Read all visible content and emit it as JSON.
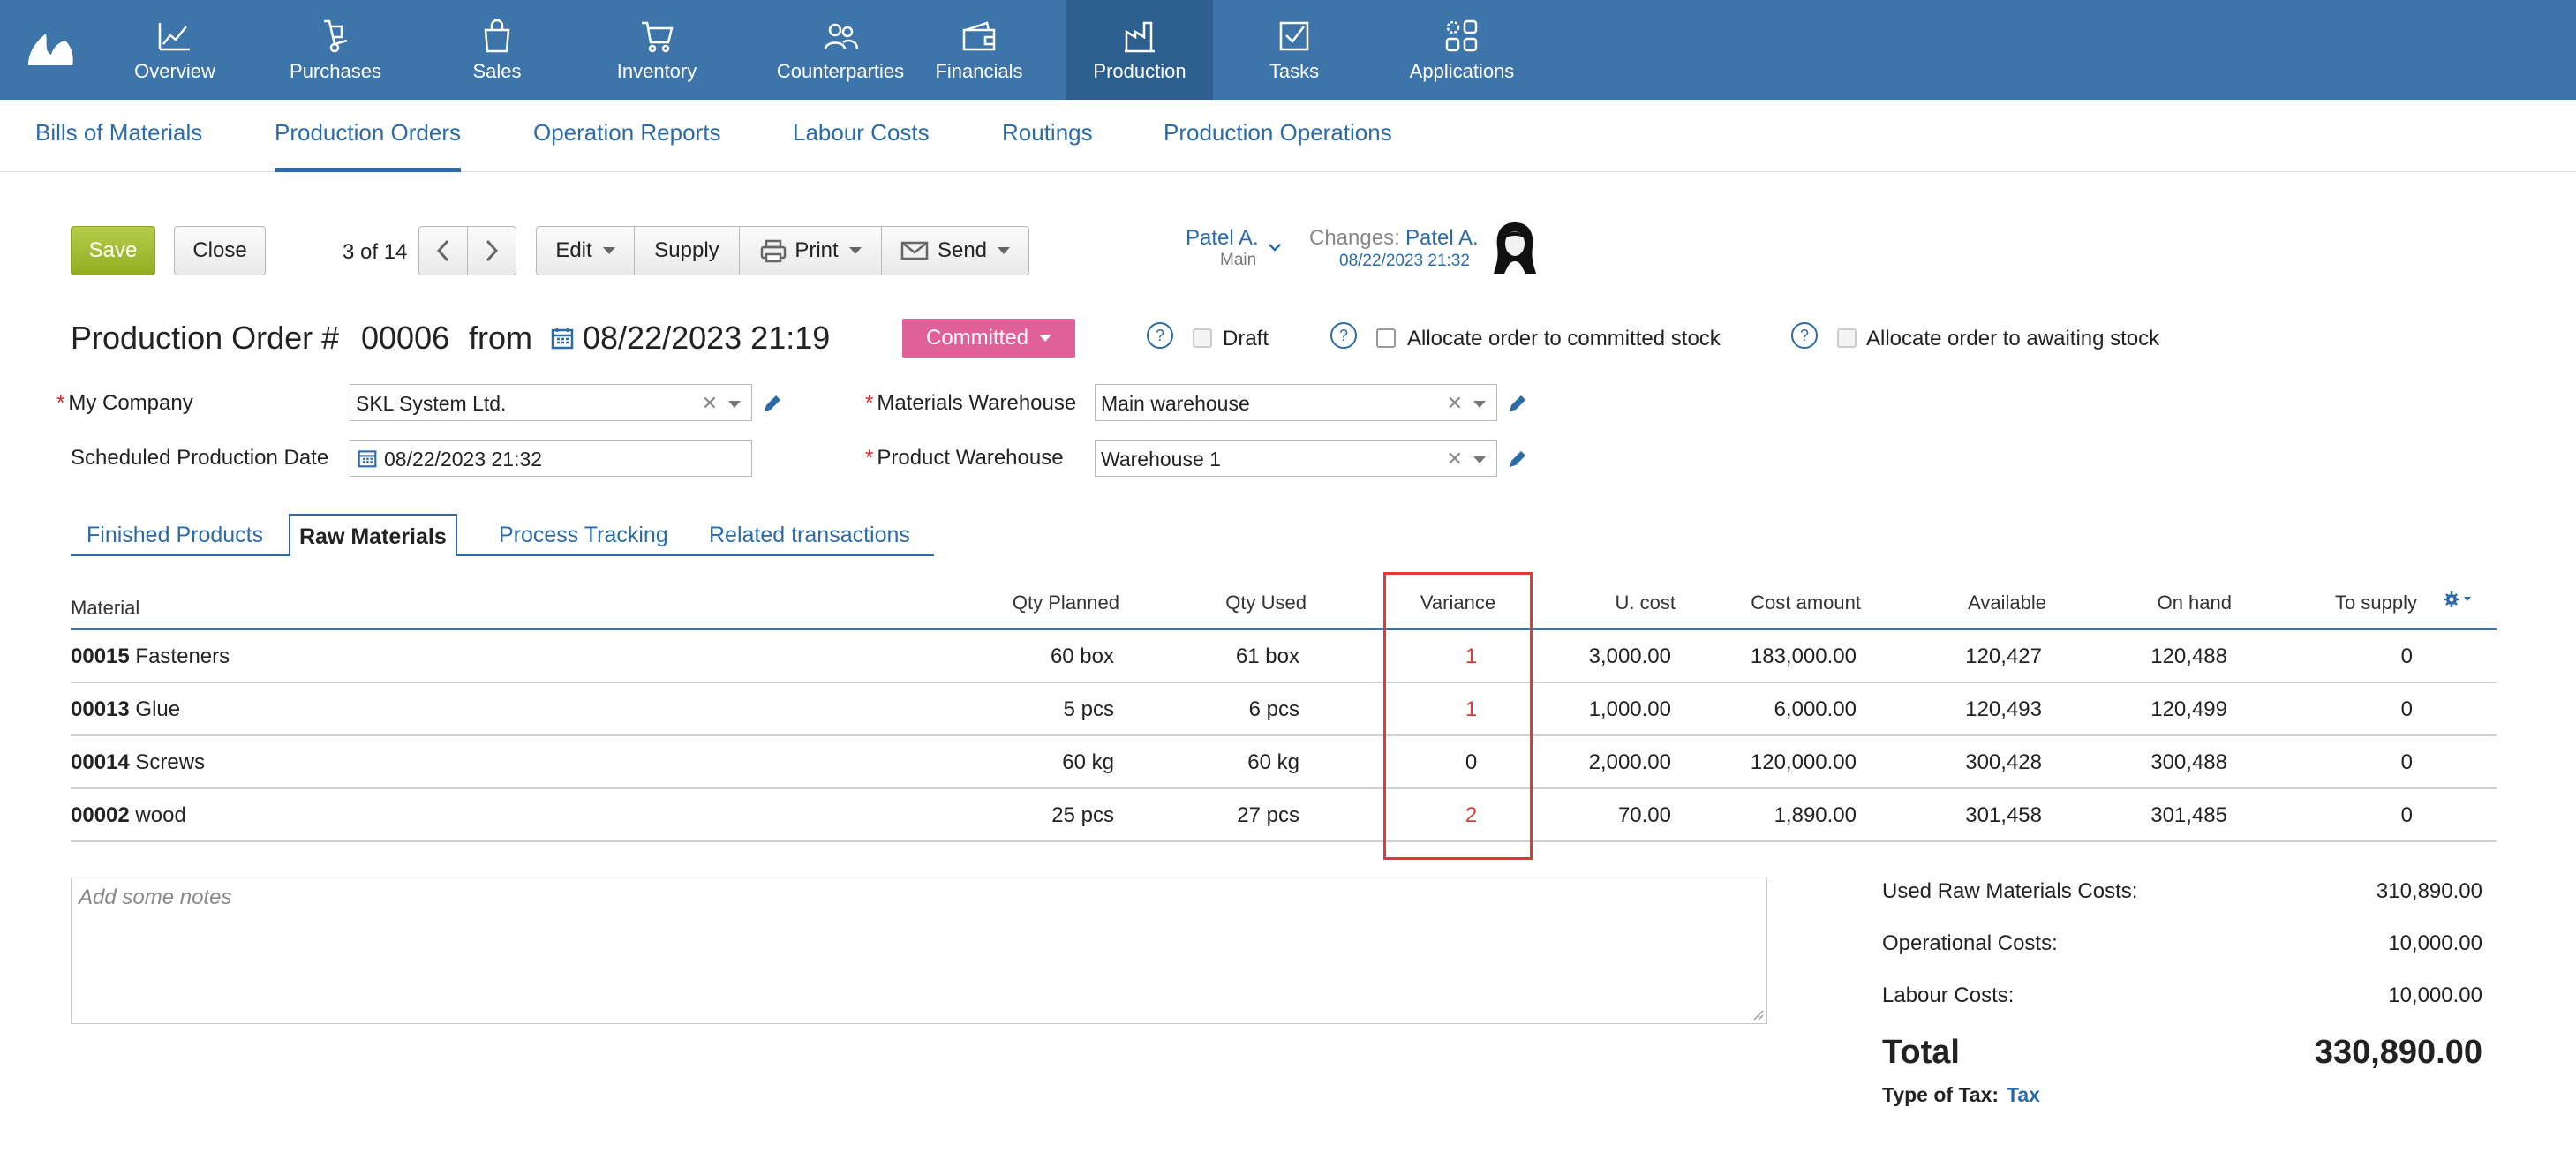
{
  "nav": {
    "items": [
      {
        "label": "Overview",
        "icon": "chart-line-icon"
      },
      {
        "label": "Purchases",
        "icon": "hand-truck-icon"
      },
      {
        "label": "Sales",
        "icon": "shopping-bag-icon"
      },
      {
        "label": "Inventory",
        "icon": "cart-icon"
      },
      {
        "label": "Counterparties",
        "icon": "people-icon"
      },
      {
        "label": "Financials",
        "icon": "wallet-icon"
      },
      {
        "label": "Production",
        "icon": "factory-icon",
        "active": true
      },
      {
        "label": "Tasks",
        "icon": "checkbox-icon"
      },
      {
        "label": "Applications",
        "icon": "apps-gear-icon"
      }
    ]
  },
  "subnav": {
    "items": [
      {
        "label": "Bills of Materials"
      },
      {
        "label": "Production Orders",
        "active": true
      },
      {
        "label": "Operation Reports"
      },
      {
        "label": "Labour Costs"
      },
      {
        "label": "Routings"
      },
      {
        "label": "Production Operations"
      }
    ]
  },
  "toolbar": {
    "save": "Save",
    "close": "Close",
    "pager": "3 of 14",
    "edit": "Edit",
    "supply": "Supply",
    "print": "Print",
    "send": "Send",
    "owner": "Patel A.",
    "owner_sub": "Main",
    "changes_label": "Changes:",
    "changes_user": "Patel A.",
    "changes_date": "08/22/2023 21:32"
  },
  "header": {
    "title_prefix": "Production Order #",
    "number": "00006",
    "from": "from",
    "date": "08/22/2023 21:19",
    "status": "Committed",
    "draft": "Draft",
    "allocate_committed": "Allocate order to committed stock",
    "allocate_awaiting": "Allocate order to awaiting stock"
  },
  "form": {
    "my_company_label": "My Company",
    "my_company_value": "SKL System Ltd.",
    "sched_label": "Scheduled Production Date",
    "sched_value": "08/22/2023 21:32",
    "mat_wh_label": "Materials Warehouse",
    "mat_wh_value": "Main warehouse",
    "prod_wh_label": "Product Warehouse",
    "prod_wh_value": "Warehouse 1"
  },
  "tabs": {
    "finished": "Finished Products",
    "raw": "Raw Materials",
    "process": "Process Tracking",
    "related": "Related transactions"
  },
  "table": {
    "headers": {
      "material": "Material",
      "qty_planned": "Qty Planned",
      "qty_used": "Qty Used",
      "variance": "Variance",
      "u_cost": "U. cost",
      "cost_amount": "Cost amount",
      "available": "Available",
      "on_hand": "On hand",
      "to_supply": "To supply"
    },
    "rows": [
      {
        "code": "00015",
        "name": "Fasteners",
        "qty_planned": "60 box",
        "qty_used": "61 box",
        "variance": "1",
        "u_cost": "3,000.00",
        "cost_amount": "183,000.00",
        "available": "120,427",
        "on_hand": "120,488",
        "to_supply": "0"
      },
      {
        "code": "00013",
        "name": "Glue",
        "qty_planned": "5 pcs",
        "qty_used": "6 pcs",
        "variance": "1",
        "u_cost": "1,000.00",
        "cost_amount": "6,000.00",
        "available": "120,493",
        "on_hand": "120,499",
        "to_supply": "0"
      },
      {
        "code": "00014",
        "name": "Screws",
        "qty_planned": "60 kg",
        "qty_used": "60 kg",
        "variance": "0",
        "u_cost": "2,000.00",
        "cost_amount": "120,000.00",
        "available": "300,428",
        "on_hand": "300,488",
        "to_supply": "0"
      },
      {
        "code": "00002",
        "name": "wood",
        "qty_planned": "25 pcs",
        "qty_used": "27 pcs",
        "variance": "2",
        "u_cost": "70.00",
        "cost_amount": "1,890.00",
        "available": "301,458",
        "on_hand": "301,485",
        "to_supply": "0"
      }
    ]
  },
  "notes": {
    "placeholder": "Add some notes"
  },
  "totals": {
    "raw_label": "Used Raw Materials Costs:",
    "raw_value": "310,890.00",
    "op_label": "Operational Costs:",
    "op_value": "10,000.00",
    "labour_label": "Labour Costs:",
    "labour_value": "10,000.00",
    "total_label": "Total",
    "total_value": "330,890.00",
    "tax_label": "Type of Tax:",
    "tax_value": "Tax"
  },
  "colors": {
    "nav_bg": "#3d74a9",
    "nav_active": "#2d5f8e",
    "link": "#2a6ba8",
    "save": "#9bb52a",
    "status": "#e0609a",
    "variance_highlight": "#e03a35"
  }
}
